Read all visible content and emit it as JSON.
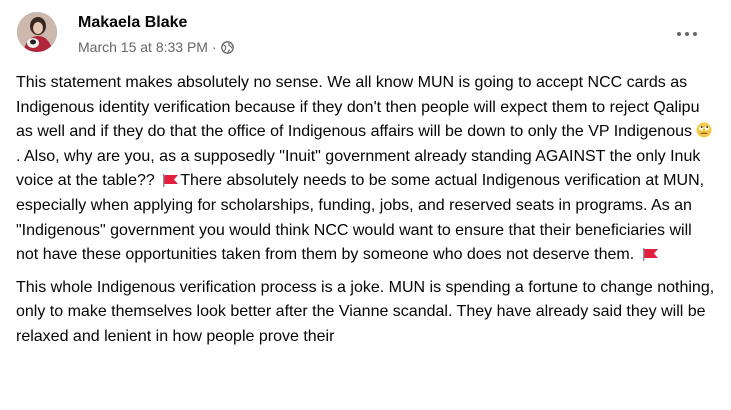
{
  "post": {
    "author": "Makaela Blake",
    "timestamp": "March 15 at 8:33 PM",
    "separator": "·",
    "privacy_icon": "globe-icon",
    "more_icon": "more-options-icon",
    "paragraph1": {
      "seg1": "This statement makes absolutely no sense. We all know MUN is going to accept NCC cards as Indigenous identity verification because if they don't then people will expect them to reject Qalipu as well and if they do that the office of Indigenous affairs will be down to only the VP Indigenous ",
      "emoji1": "rolling-eyes-emoji",
      "seg2": ". Also, why are you, as a supposedly \"Inuit\" government already standing AGAINST the only Inuk voice at the table?? ",
      "flag1": "red-flag-emoji",
      "seg3": "There absolutely needs to be some actual Indigenous verification at MUN, especially when applying for scholarships, funding, jobs, and reserved seats in programs. As an \"Indigenous\" government you would think NCC would want to ensure that their beneficiaries will not have these opportunities taken from them by someone who does not deserve them. ",
      "flag2": "red-flag-emoji"
    },
    "paragraph2": "This whole Indigenous verification process is a joke. MUN is spending a fortune to change nothing, only to make themselves look better after the Vianne scandal. They have already said they will be relaxed and lenient in how people prove their"
  },
  "colors": {
    "text": "#050505",
    "secondary": "#65676b",
    "flag": "#e41e3f"
  }
}
